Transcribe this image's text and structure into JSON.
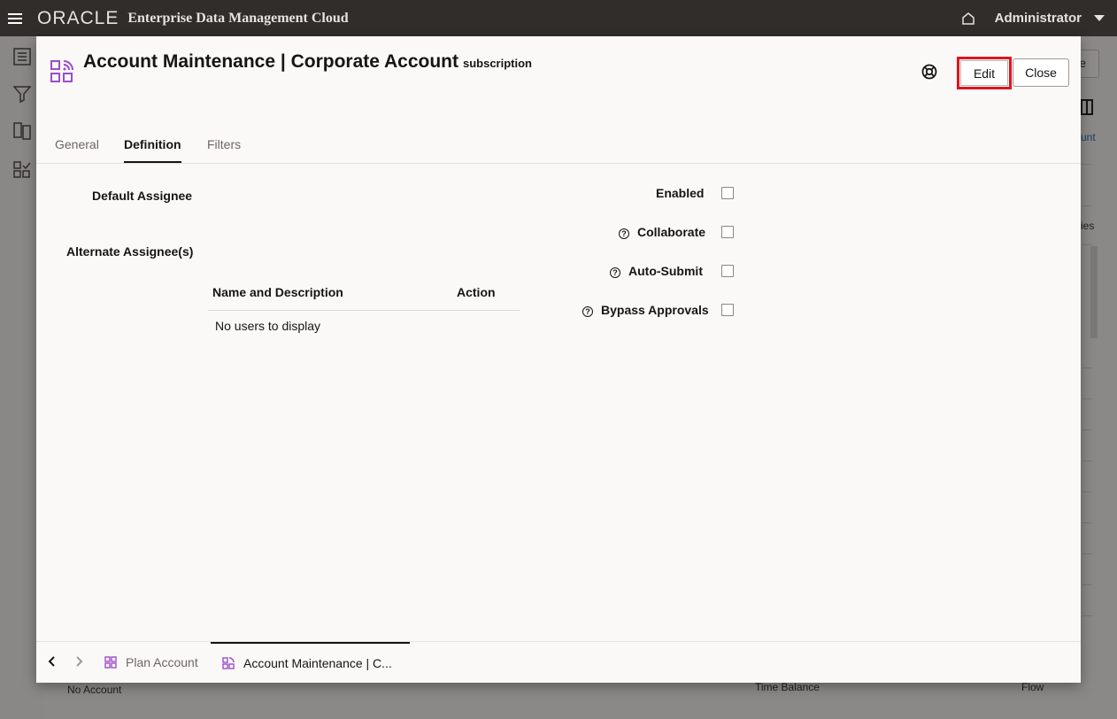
{
  "topbar": {
    "brand": "ORACLE",
    "product": "Enterprise Data Management Cloud",
    "user": "Administrator"
  },
  "background": {
    "button_fragment": "e",
    "link_fragment": "unt",
    "col_fragment": "ies",
    "row_label": "No Account",
    "time_balance": "Time Balance",
    "flow": "Flow"
  },
  "dialog": {
    "title": "Account Maintenance | Corporate Account",
    "subtitle": "subscription",
    "edit_label": "Edit",
    "close_label": "Close",
    "tabs": [
      {
        "label": "General",
        "active": false
      },
      {
        "label": "Definition",
        "active": true
      },
      {
        "label": "Filters",
        "active": false
      }
    ],
    "fields": {
      "default_assignee": "Default Assignee",
      "alternate_assignees": "Alternate Assignee(s)",
      "enabled": "Enabled",
      "collaborate": "Collaborate",
      "auto_submit": "Auto-Submit",
      "bypass_approvals": "Bypass Approvals"
    },
    "table": {
      "columns": [
        "Name and Description",
        "Action"
      ],
      "empty_text": "No users to display"
    },
    "footer_tabs": [
      {
        "label": "Plan Account",
        "active": false
      },
      {
        "label": "Account Maintenance | C...",
        "active": true
      }
    ]
  },
  "colors": {
    "topbar": "#312d2a",
    "highlight": "#e0141d",
    "app_icon": "#9b4dca"
  }
}
